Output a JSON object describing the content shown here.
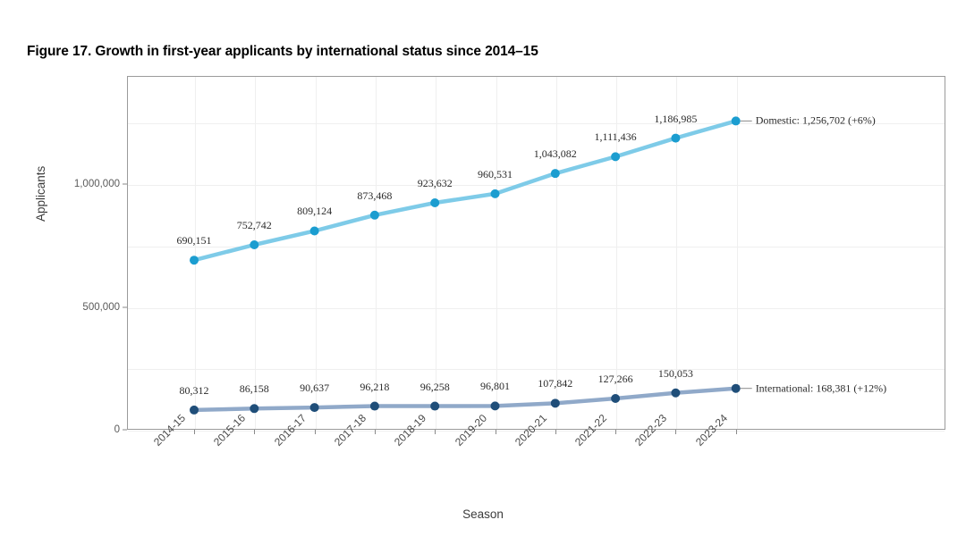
{
  "figure": {
    "title": "Figure 17. Growth in first-year applicants by international status since 2014–15"
  },
  "chart_data": {
    "type": "line",
    "title": "Figure 17. Growth in first-year applicants by international status since 2014–15",
    "xlabel": "Season",
    "ylabel": "Applicants",
    "categories": [
      "2014-15",
      "2015-16",
      "2016-17",
      "2017-18",
      "2018-19",
      "2019-20",
      "2020-21",
      "2021-22",
      "2022-23",
      "2023-24"
    ],
    "ylim": [
      0,
      1350000
    ],
    "yticks": [
      0,
      500000,
      1000000
    ],
    "ytick_labels": [
      "0",
      "500,000",
      "1,000,000"
    ],
    "gridlines": [
      0,
      250000,
      500000,
      750000,
      1000000,
      1250000
    ],
    "grid": true,
    "legend_position": "direct-end-labels",
    "series": [
      {
        "name": "Domestic",
        "color": "#7ecbe8",
        "marker_color": "#1b9dd0",
        "values": [
          690151,
          752742,
          809124,
          873468,
          923632,
          960531,
          1043082,
          1111436,
          1186985,
          1256702
        ],
        "labels": [
          "690,151",
          "752,742",
          "809,124",
          "873,468",
          "923,632",
          "960,531",
          "1,043,082",
          "1,111,436",
          "1,186,985",
          ""
        ],
        "end_label": "Domestic: 1,256,702 (+6%)",
        "growth": "+6%"
      },
      {
        "name": "International",
        "color": "#90a9c9",
        "marker_color": "#1f4e79",
        "values": [
          80312,
          86158,
          90637,
          96218,
          96258,
          96801,
          107842,
          127266,
          150053,
          168381
        ],
        "labels": [
          "80,312",
          "86,158",
          "90,637",
          "96,218",
          "96,258",
          "96,801",
          "107,842",
          "127,266",
          "150,053",
          ""
        ],
        "end_label": "International: 168,381 (+12%)",
        "growth": "+12%"
      }
    ]
  }
}
